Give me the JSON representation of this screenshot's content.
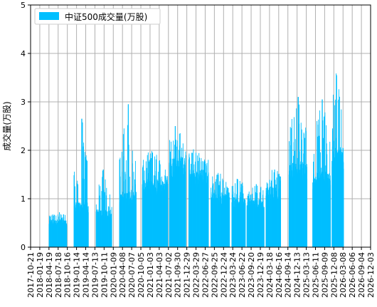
{
  "chart_data": {
    "type": "bar",
    "title": "",
    "xlabel": "",
    "ylabel": "成交量(万股)",
    "legend": {
      "position": "top-left",
      "entries": [
        "中证500成交量(万股)"
      ]
    },
    "grid": true,
    "ylim": [
      0,
      5
    ],
    "yticks": [
      "0",
      "1",
      "2",
      "3",
      "4",
      "5"
    ],
    "x_tick_labels": [
      "2017-10-21",
      "2018-01-19",
      "2018-04-19",
      "2018-07-18",
      "2018-10-16",
      "2019-01-14",
      "2019-04-14",
      "2019-07-13",
      "2019-10-11",
      "2020-01-09",
      "2020-04-08",
      "2020-07-07",
      "2020-10-05",
      "2021-01-03",
      "2021-04-03",
      "2021-07-02",
      "2021-09-30",
      "2021-12-29",
      "2022-03-29",
      "2022-06-27",
      "2022-09-25",
      "2022-12-24",
      "2023-03-24",
      "2023-06-22",
      "2023-09-20",
      "2023-12-19",
      "2024-03-18",
      "2024-06-16",
      "2024-09-14",
      "2024-12-13",
      "2025-03-13",
      "2025-06-11",
      "2025-09-09",
      "2025-12-08",
      "2026-03-08",
      "2026-06-06",
      "2026-09-04",
      "2026-12-03"
    ],
    "series": [
      {
        "name": "中证500成交量(万股)",
        "color": "#00bfff",
        "segments": [
          {
            "start": "2018-04-20",
            "end": "2018-10-10",
            "base": 0.55,
            "peak": 0.72
          },
          {
            "start": "2018-12-20",
            "end": "2019-05-10",
            "base": 0.9,
            "peak": 2.65
          },
          {
            "start": "2019-07-25",
            "end": "2019-12-25",
            "base": 0.75,
            "peak": 1.6
          },
          {
            "start": "2020-03-10",
            "end": "2020-08-20",
            "base": 1.1,
            "peak": 2.95
          },
          {
            "start": "2020-10-20",
            "end": "2021-06-25",
            "base": 1.35,
            "peak": 1.95
          },
          {
            "start": "2021-07-10",
            "end": "2021-12-20",
            "base": 1.8,
            "peak": 2.5
          },
          {
            "start": "2022-01-15",
            "end": "2022-07-30",
            "base": 1.55,
            "peak": 1.95
          },
          {
            "start": "2022-08-20",
            "end": "2023-02-20",
            "base": 1.1,
            "peak": 1.5
          },
          {
            "start": "2023-03-15",
            "end": "2023-07-25",
            "base": 1.0,
            "peak": 1.4
          },
          {
            "start": "2023-08-10",
            "end": "2024-01-25",
            "base": 0.95,
            "peak": 1.3
          },
          {
            "start": "2024-02-10",
            "end": "2024-07-05",
            "base": 1.2,
            "peak": 1.6
          },
          {
            "start": "2024-09-25",
            "end": "2025-03-20",
            "base": 1.7,
            "peak": 3.1
          },
          {
            "start": "2025-05-15",
            "end": "2025-11-05",
            "base": 1.5,
            "peak": 3.05
          },
          {
            "start": "2025-11-20",
            "end": "2026-03-15",
            "base": 2.0,
            "peak": 3.55
          }
        ]
      }
    ]
  }
}
